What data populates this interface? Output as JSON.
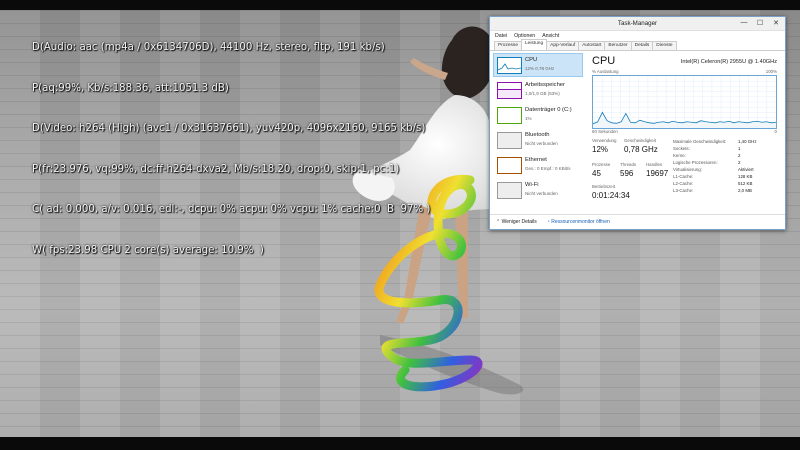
{
  "osd": {
    "lines": [
      "D(Audio: aac (mp4a / 0x6134706D), 44100 Hz, stereo, fltp, 191 kb/s)",
      "P(aq:99%, Kb/s:188.36, att:1051.3 dB)",
      "D(Video: h264 (High) (avc1 / 0x31637661), yuv420p, 4096x2160, 9165 kb/s)",
      "P(fr:23.976, vq:99%, dc:ff-h264-dxva2, Mb/s:18.20, drop:0, skip:1, pc:1)",
      "C( ad: 0.000, a/v: 0.016, edl:-, dcpu: 0% acpu: 0% vcpu: 1% cache:0  B  97% )",
      "W( fps:23.98 CPU 2 core(s) average: 10.9%  )"
    ]
  },
  "task_manager": {
    "title": "Task-Manager",
    "controls": {
      "min": "—",
      "max": "☐",
      "close": "✕"
    },
    "menu": [
      "Datei",
      "Optionen",
      "Ansicht"
    ],
    "tabs": [
      "Prozesse",
      "Leistung",
      "App-Verlauf",
      "Autostart",
      "Benutzer",
      "Details",
      "Dienste"
    ],
    "active_tab": "Leistung",
    "sidebar": [
      {
        "name": "CPU",
        "value": "12% 0,78 GHz",
        "color": "#117dbb"
      },
      {
        "name": "Arbeitsspeicher",
        "value": "1,0/1,9 GB (53%)",
        "color": "#8b12ae"
      },
      {
        "name": "Datenträger 0 (C:)",
        "value": "1%",
        "color": "#4da60c"
      },
      {
        "name": "Bluetooth",
        "value": "Nicht verbunden",
        "color": "#999999"
      },
      {
        "name": "Ethernet",
        "value": "Ges.: 0 Empf.: 0 KBit/s",
        "color": "#a74f01"
      },
      {
        "name": "Wi-Fi",
        "value": "Nicht verbunden",
        "color": "#999999"
      }
    ],
    "cpu": {
      "title": "CPU",
      "model": "Intel(R) Celeron(R) 2955U @ 1.40GHz",
      "graph_label_left": "% Auslastung",
      "graph_label_right": "100%",
      "graph_foot_left": "60 Sekunden",
      "graph_foot_right": "0",
      "graph_series": [
        8,
        12,
        30,
        14,
        10,
        9,
        12,
        28,
        11,
        10,
        15,
        12,
        10,
        9,
        11,
        12,
        10,
        13,
        11,
        10,
        12,
        11,
        10,
        14,
        12,
        11,
        10,
        12,
        11,
        13,
        10,
        12,
        11,
        10,
        12,
        13,
        11,
        12,
        10,
        11
      ],
      "stats": [
        {
          "label": "Verwendung",
          "value": "12%"
        },
        {
          "label": "Geschwindigkeit",
          "value": "0,78 GHz"
        },
        {
          "label": "Prozesse",
          "value": "45"
        },
        {
          "label": "Threads",
          "value": "596"
        },
        {
          "label": "Handles",
          "value": "19697"
        },
        {
          "label": "Betriebszeit",
          "value": "0:01:24:34"
        }
      ],
      "details": [
        {
          "k": "Maximale Geschwindigkeit:",
          "v": "1,40 GHz"
        },
        {
          "k": "Sockets:",
          "v": "1"
        },
        {
          "k": "Kerne:",
          "v": "2"
        },
        {
          "k": "Logische Prozessoren:",
          "v": "2"
        },
        {
          "k": "Virtualisierung:",
          "v": "Aktiviert"
        },
        {
          "k": "L1-Cache:",
          "v": "128 KB"
        },
        {
          "k": "L2-Cache:",
          "v": "512 KB"
        },
        {
          "k": "L3-Cache:",
          "v": "2,0 MB"
        }
      ]
    },
    "footer": {
      "less": "Weniger Details",
      "monitor": "Ressourcenmonitor öffnen"
    }
  }
}
